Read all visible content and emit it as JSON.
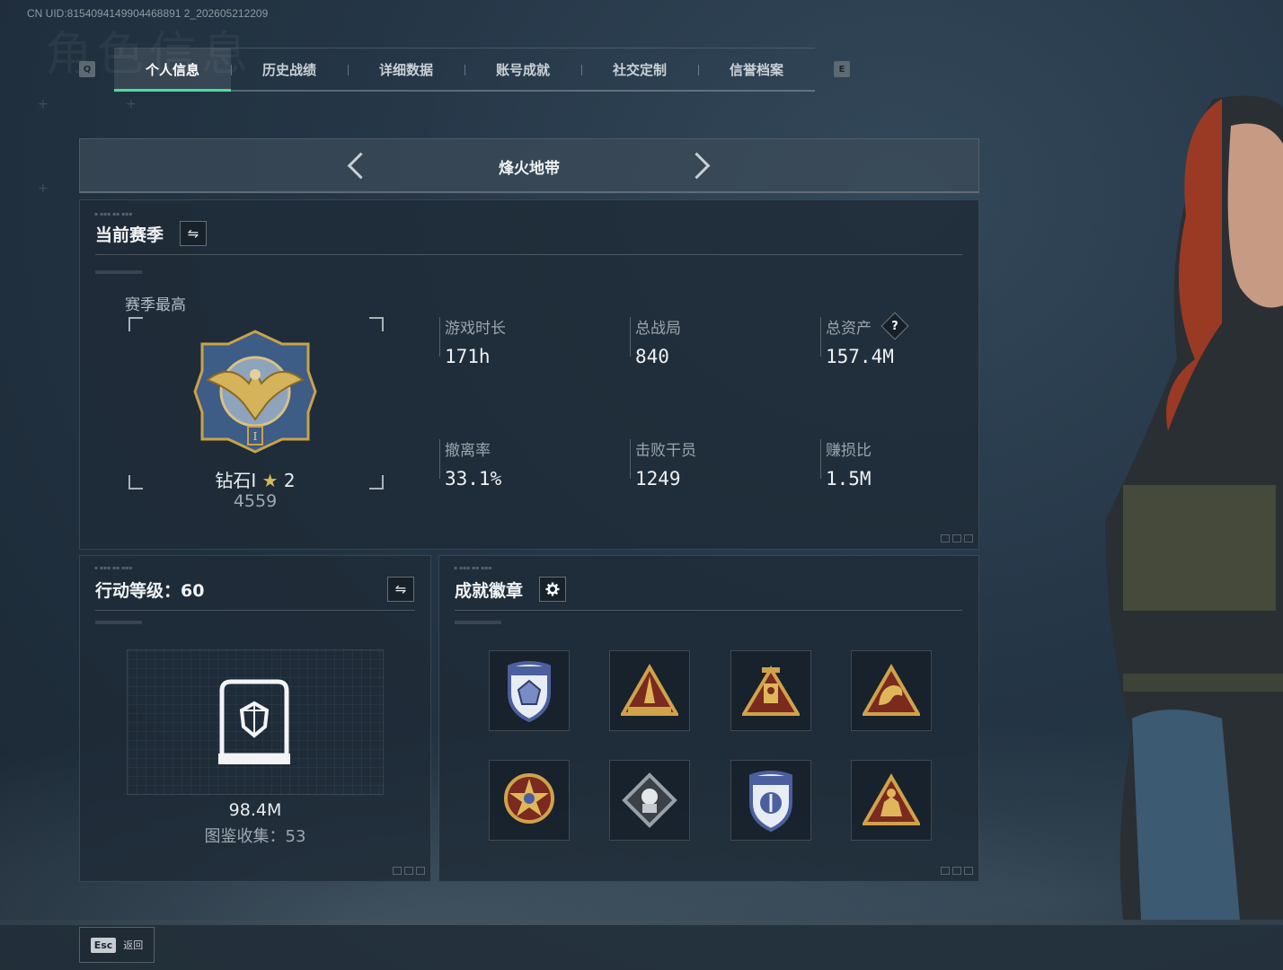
{
  "uid": "CN UID:8154094149904468891 2_202605212209",
  "background_title": "角色信息",
  "tabs": {
    "prev_key": "Q",
    "next_key": "E",
    "items": [
      {
        "label": "个人信息",
        "active": true
      },
      {
        "label": "历史战绩",
        "active": false
      },
      {
        "label": "详细数据",
        "active": false
      },
      {
        "label": "账号成就",
        "active": false
      },
      {
        "label": "社交定制",
        "active": false
      },
      {
        "label": "信誉档案",
        "active": false
      }
    ]
  },
  "mode_switcher": {
    "title": "烽火地带"
  },
  "season": {
    "title": "当前赛季",
    "switch_icon": "⇋",
    "best_label": "赛季最高",
    "rank_name": "钻石I",
    "rank_stars": "2",
    "rank_score": "4559",
    "stats": [
      {
        "label": "游戏时长",
        "value": "171h"
      },
      {
        "label": "总战局",
        "value": "840"
      },
      {
        "label": "总资产",
        "value": "157.4M",
        "help": "?"
      },
      {
        "label": "撤离率",
        "value": "33.1%"
      },
      {
        "label": "击败干员",
        "value": "1249"
      },
      {
        "label": "赚损比",
        "value": "1.5M"
      }
    ]
  },
  "level": {
    "title": "行动等级：60",
    "switch_icon": "⇋",
    "value": "98.4M",
    "collection": "图鉴收集：53"
  },
  "badges": {
    "title": "成就徽章",
    "settings_icon": "gear-icon",
    "items": [
      {
        "icon": "shield-star-badge",
        "color": "#4b5f9e"
      },
      {
        "icon": "rocket-triangle-badge",
        "color": "#b8892f"
      },
      {
        "icon": "tower-triangle-badge",
        "color": "#b8892f"
      },
      {
        "icon": "dragon-triangle-badge",
        "color": "#b8892f"
      },
      {
        "icon": "compass-star-badge",
        "color": "#c24a3a"
      },
      {
        "icon": "rose-diamond-badge",
        "color": "#8a9099"
      },
      {
        "icon": "shield-emblem-badge",
        "color": "#4b5f9e"
      },
      {
        "icon": "beast-triangle-badge",
        "color": "#b8892f"
      }
    ]
  },
  "footer": {
    "esc_key": "Esc",
    "back_label": "返回"
  },
  "colors": {
    "accent": "#4ddc9c",
    "gold": "#c9a24a"
  }
}
